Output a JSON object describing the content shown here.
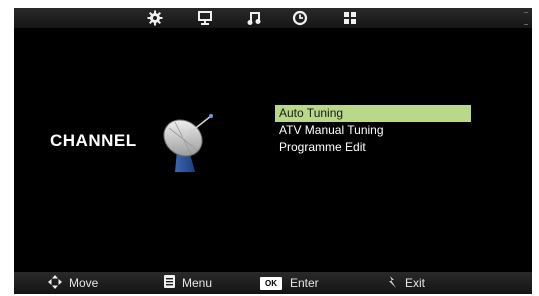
{
  "top_bar": {
    "icons": [
      "gear-icon",
      "monitor-icon",
      "music-note-icon",
      "clock-icon",
      "grid-icon"
    ],
    "active_tab": "channel"
  },
  "section": {
    "title": "CHANNEL",
    "icon": "satellite-dish-icon"
  },
  "menu": {
    "items": [
      {
        "label": "Auto Tuning",
        "selected": true
      },
      {
        "label": "ATV Manual Tuning",
        "selected": false
      },
      {
        "label": "Programme Edit",
        "selected": false
      }
    ],
    "highlight_color": "#b9d88a"
  },
  "bottom_bar": {
    "move_label": "Move",
    "menu_label": "Menu",
    "ok_badge": "OK",
    "enter_label": "Enter",
    "exit_label": "Exit"
  }
}
